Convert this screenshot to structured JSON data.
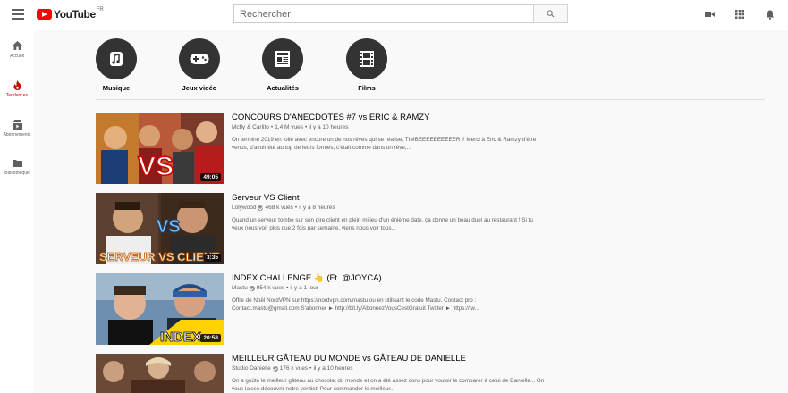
{
  "header": {
    "logo_text": "YouTube",
    "region": "FR",
    "search_placeholder": "Rechercher"
  },
  "sidebar": {
    "items": [
      {
        "label": "Accueil",
        "icon": "home-icon",
        "active": false
      },
      {
        "label": "Tendances",
        "icon": "flame-icon",
        "active": true
      },
      {
        "label": "Abonnements",
        "icon": "subscriptions-icon",
        "active": false
      },
      {
        "label": "Bibliothèque",
        "icon": "library-icon",
        "active": false
      }
    ]
  },
  "categories": [
    {
      "label": "Musique",
      "icon": "music-note-icon"
    },
    {
      "label": "Jeux vidéo",
      "icon": "gamepad-icon"
    },
    {
      "label": "Actualités",
      "icon": "newspaper-icon"
    },
    {
      "label": "Films",
      "icon": "film-icon"
    }
  ],
  "videos": [
    {
      "title": "CONCOURS D'ANECDOTES #7 vs ERIC & RAMZY",
      "channel": "Mcfly & Carlito",
      "verified": false,
      "views": "1,4 M vues",
      "age": "il y a 10 heures",
      "description": "On termine 2019 en folie avec encore un de nos rêves qui se réalise, TIMBEEEEEEEEEER !! Merci à Eric & Ramzy d'être venus, d'avoir été au top de leurs formes, c'était comme dans un rêve,...",
      "duration": "49:05",
      "thumb_overlay": "VS"
    },
    {
      "title": "Serveur VS Client",
      "channel": "Lolywood",
      "verified": true,
      "views": "468 k vues",
      "age": "il y a 8 heures",
      "description": "Quand un serveur tombe sur son pire client en plein milieu d'un énième date, ça donne un beau duel au restaurant ! Si tu veux nous voir plus que 2 fois par semaine, viens nous voir tous...",
      "duration": "3:35",
      "thumb_overlay": "SERVEUR VS CLIENT"
    },
    {
      "title": "INDEX CHALLENGE 👆 (Ft. @JOYCA)",
      "channel": "Mastu",
      "verified": true,
      "views": "954 k vues",
      "age": "il y a 1 jour",
      "description": "Offre de Noël NordVPN sur https://nordvpn.com/mastu ou en utilisant le code Mastu. Contact pro : Contact.mastu@gmail.com S'abonner ► http://bit.ly/AbonnezVousCestGratuit Twitter ► https://tw...",
      "duration": "20:58",
      "thumb_overlay": "INDEX"
    },
    {
      "title": "MEILLEUR GÂTEAU DU MONDE vs GÂTEAU DE DANIELLE",
      "channel": "Studio Danielle",
      "verified": true,
      "views": "176 k vues",
      "age": "il y a 10 heures",
      "description": "On a goûté le meilleur gâteau au chocolat du monde et on a été assez cons pour vouloir le comparer à celui de Danielle... On vous laisse découvrir notre verdict! Pour commander le meilleur...",
      "duration": "",
      "thumb_overlay": ""
    }
  ]
}
